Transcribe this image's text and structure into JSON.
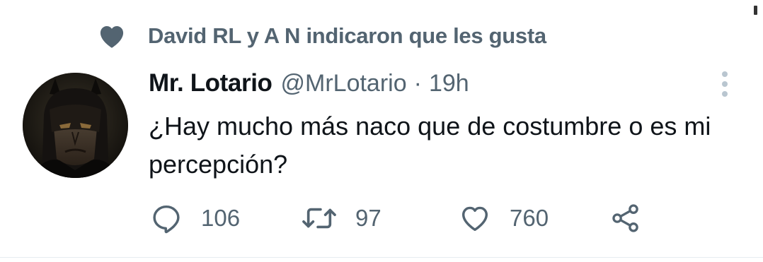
{
  "social_context": {
    "icon": "heart-icon",
    "text": "David RL y A N indicaron que les gusta"
  },
  "tweet": {
    "author": {
      "display_name": "Mr. Lotario",
      "handle": "@MrLotario",
      "avatar": "batman-avatar"
    },
    "separator": "·",
    "time": "19h",
    "text": "¿Hay mucho más naco que de costumbre o es mi percepción?",
    "more_icon": "more-vertical-icon",
    "actions": {
      "reply": {
        "icon": "reply-icon",
        "count": "106"
      },
      "retweet": {
        "icon": "retweet-icon",
        "count": "97"
      },
      "like": {
        "icon": "heart-outline-icon",
        "count": "760"
      },
      "share": {
        "icon": "share-icon"
      }
    }
  },
  "colors": {
    "primary_text": "#0f1419",
    "secondary_text": "#536471",
    "background": "#ffffff",
    "more_icon": "#b9c6d0"
  }
}
